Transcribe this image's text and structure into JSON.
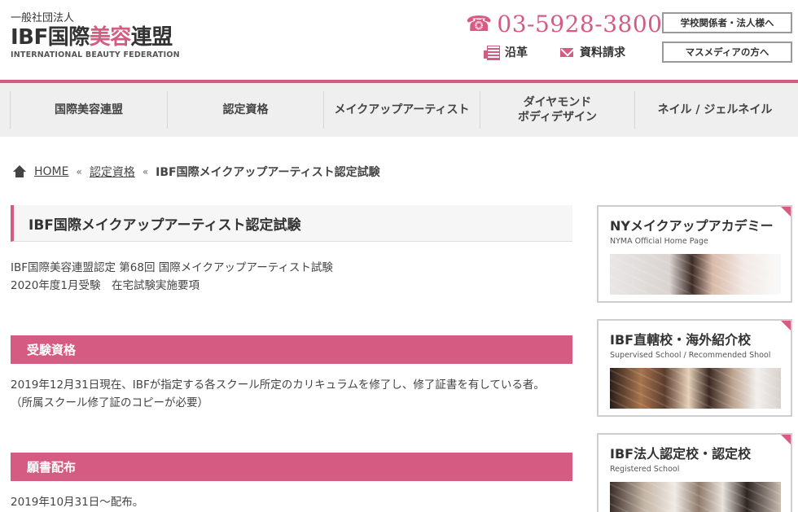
{
  "header": {
    "org_type": "一般社団法人",
    "logo_part1": "IBF国際",
    "logo_part2": "美容",
    "logo_part3": "連盟",
    "logo_en": "INTERNATIONAL BEAUTY FEDERATION",
    "phone": "03-5928-3800",
    "link_history": "沿革",
    "link_docs": "資料請求",
    "btn_school": "学校関係者・法人様へ",
    "btn_media": "マスメディアの方へ"
  },
  "nav": {
    "items": [
      {
        "label": "国際美容連盟"
      },
      {
        "label": "認定資格"
      },
      {
        "label": "メイクアップアーティスト"
      },
      {
        "label_line1": "ダイヤモンド",
        "label_line2": "ボディデザイン"
      },
      {
        "label": "ネイル / ジェルネイル"
      }
    ]
  },
  "breadcrumb": {
    "home": "HOME",
    "sep": "«",
    "level1": "認定資格",
    "current": "IBF国際メイクアップアーティスト認定試験"
  },
  "main": {
    "title": "IBF国際メイクアップアーティスト認定試験",
    "intro_line1": "IBF国際美容連盟認定 第68回 国際メイクアップアーティスト試験",
    "intro_line2": "2020年度1月受験　在宅試験実施要項",
    "sections": [
      {
        "heading": "受験資格",
        "line1": "2019年12月31日現在、IBFが指定する各スクール所定のカリキュラムを修了し、修了証書を有している者。",
        "line2": "（所属スクール修了証のコピーが必要）"
      },
      {
        "heading": "願書配布",
        "line1": "2019年10月31日～配布。"
      }
    ]
  },
  "sidebar": {
    "cards": [
      {
        "title": "NYメイクアップアカデミー",
        "subtitle": "NYMA Official Home Page"
      },
      {
        "title": "IBF直轄校・海外紹介校",
        "subtitle": "Supervised School / Recommended Shool"
      },
      {
        "title": "IBF法人認定校・認定校",
        "subtitle": "Registered School"
      }
    ]
  },
  "colors": {
    "accent": "#d65b82",
    "nav_bg": "#efefef"
  }
}
